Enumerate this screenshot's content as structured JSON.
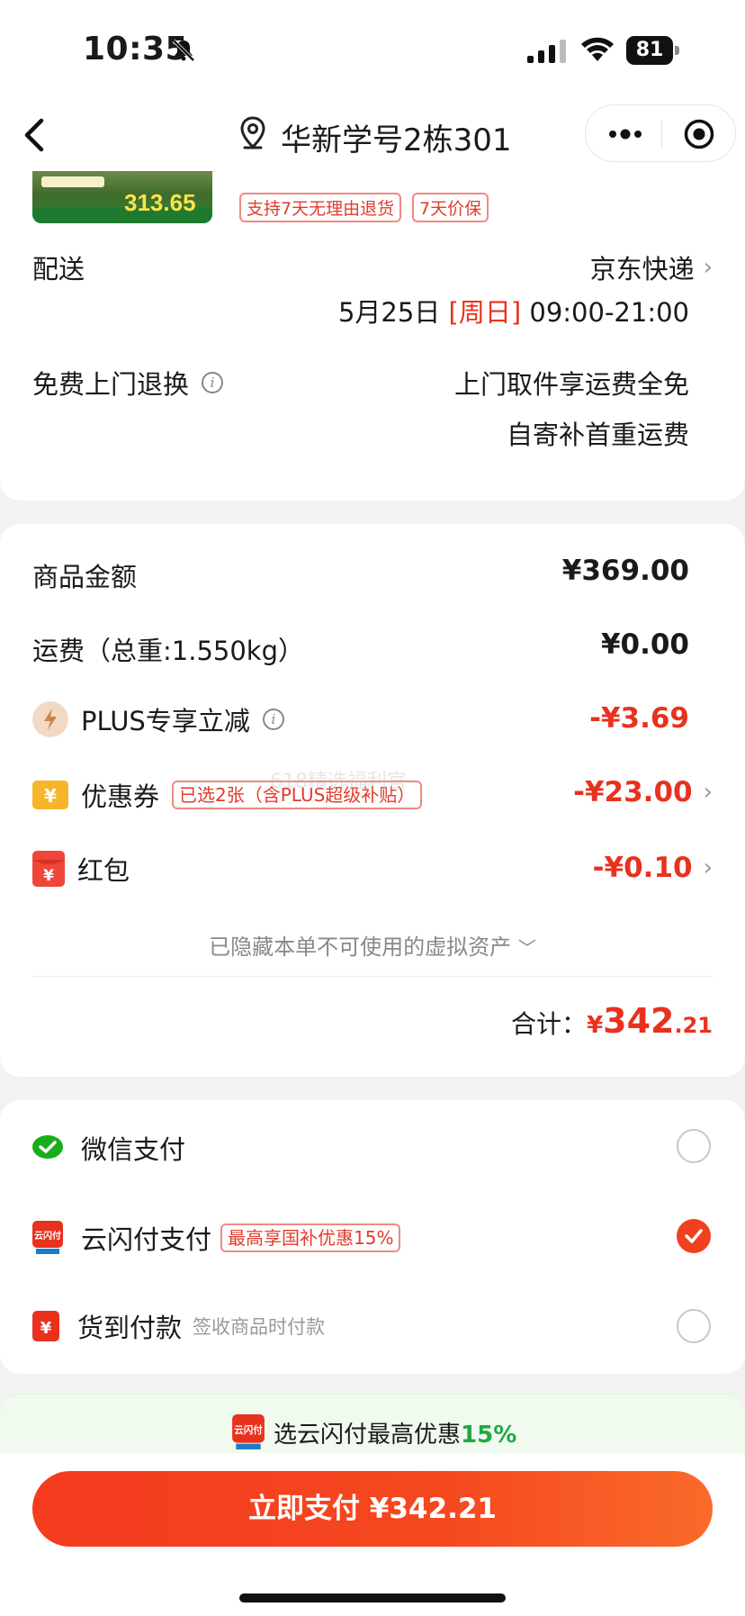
{
  "status_bar": {
    "time": "10:35",
    "battery": "81"
  },
  "nav": {
    "title": "华新学号2栋301"
  },
  "product": {
    "thumb_price": "313.65",
    "badges": [
      "支持7天无理由退货",
      "7天价保"
    ]
  },
  "delivery": {
    "label": "配送",
    "carrier": "京东快递",
    "date": "5月25日",
    "weekday": "[周日]",
    "time_window": "09:00-21:00"
  },
  "returns": {
    "label": "免费上门退换",
    "line1": "上门取件享运费全免",
    "line2": "自寄补首重运费"
  },
  "summary": {
    "goods_label": "商品金额",
    "goods_value": "¥369.00",
    "shipping_label": "运费（总重:1.550kg）",
    "shipping_value": "¥0.00",
    "plus_label": "PLUS专享立减",
    "plus_value": "-¥3.69",
    "coupon_label": "优惠券",
    "coupon_tag": "已选2张（含PLUS超级补贴）",
    "coupon_value": "-¥23.00",
    "redpacket_label": "红包",
    "redpacket_value": "-¥0.10",
    "hidden_assets": "已隐藏本单不可使用的虚拟资产",
    "total_label": "合计：",
    "total_symbol": "¥",
    "total_int": "342",
    "total_dec": ".21",
    "watermark": "618精选福利官"
  },
  "payment": {
    "wechat": "微信支付",
    "unionpay": "云闪付支付",
    "unionpay_tag": "最高享国补优惠15%",
    "cod": "货到付款",
    "cod_note": "签收商品时付款",
    "selected": "unionpay"
  },
  "promo": {
    "text": "选云闪付最高优惠",
    "highlight": "15%"
  },
  "pay_button": "立即支付 ¥342.21",
  "colors": {
    "accent": "#e8321e",
    "green": "#21a845",
    "wechat": "#1aad19"
  }
}
